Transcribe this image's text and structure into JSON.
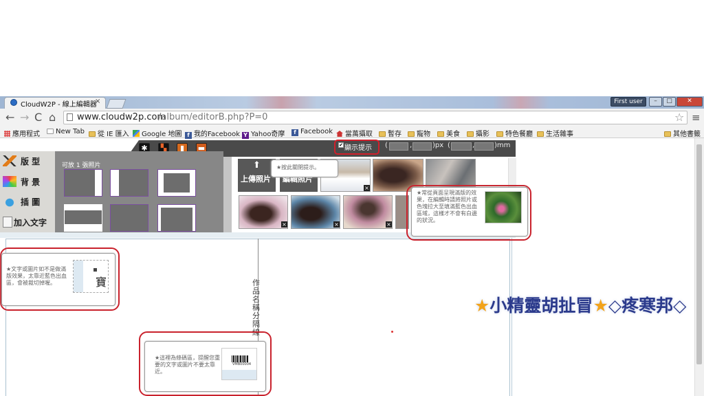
{
  "browser": {
    "tab_title": "CloudW2P - 線上編輯器",
    "tab_close": "×",
    "user_label": "First user",
    "url_host": "www.cloudw2p.com",
    "url_path": "/album/editorB.php?P=0",
    "window_buttons": {
      "minimize": "–",
      "maximize": "□",
      "close": "✕"
    },
    "nav": {
      "back": "←",
      "forward": "→",
      "reload": "C",
      "home": "⌂",
      "star": "☆",
      "menu": "≡"
    }
  },
  "bookmarks": [
    {
      "label": "應用程式",
      "icon": "apps-icon"
    },
    {
      "label": "New Tab",
      "icon": "page-icon"
    },
    {
      "label": "從 IE 匯入",
      "icon": "folder-icon"
    },
    {
      "label": "Google 地圖",
      "icon": "maps-icon"
    },
    {
      "label": "我的Facebook",
      "icon": "facebook-icon"
    },
    {
      "label": "Yahoo奇摩",
      "icon": "yahoo-icon"
    },
    {
      "label": "Facebook",
      "icon": "facebook-icon"
    },
    {
      "label": "當萬攝取",
      "icon": "home-icon"
    },
    {
      "label": "暫存",
      "icon": "folder-icon"
    },
    {
      "label": "寵物",
      "icon": "folder-icon"
    },
    {
      "label": "美食",
      "icon": "folder-icon"
    },
    {
      "label": "攝影",
      "icon": "folder-icon"
    },
    {
      "label": "特色餐廳",
      "icon": "folder-icon"
    },
    {
      "label": "生活雜事",
      "icon": "folder-icon"
    }
  ],
  "other_bookmarks": "其他書籤",
  "editor": {
    "show_hint_label": "顯示提示",
    "checkbox_mark": "✔",
    "dims": {
      "sep": ",",
      "unit_px": ")px",
      "unit_mm": ")mm",
      "open": "("
    },
    "side_menu": [
      {
        "label": "版 型",
        "icon": "layout-icon"
      },
      {
        "label": "背 景",
        "icon": "background-icon"
      },
      {
        "label": "插 圖",
        "icon": "clipart-icon"
      },
      {
        "label": "加入文字",
        "icon": "text-icon"
      }
    ],
    "panel_label": "可放 1 張照片",
    "upload_label": "上傳照片",
    "upload_arrow": "⬆",
    "edit_label": "編輯照片",
    "tips": {
      "close_hint": "★按此關閉提示。",
      "photo_tip": "★常從頁面呈現滿版的效果，在編輯時請將照片或色塊拉大至填滿藍色出血區域，這樣才不會有白邊的狀況。",
      "bleed_tip": "★文字或圖片如不是做滿版效果，太靠近藍色出血區，會被裁切掉喔。",
      "barcode_tip": "★這裡為條碼區，提醒您重要的文字或圖片不要太靠近。",
      "bleed_char": "寶",
      "barcode_number": "VMB00004"
    },
    "spine_title": "作品名稱分隔線",
    "x_mark": "×"
  },
  "watermark": {
    "text1": "★",
    "text2": "小精靈胡扯冒",
    "text3": "★",
    "text4": "◇疼寒邦◇"
  }
}
